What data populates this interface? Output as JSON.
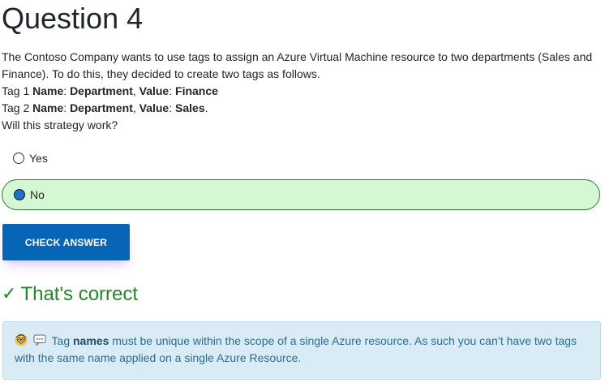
{
  "question": {
    "title": "Question 4",
    "intro": "The Contoso Company wants to use tags to assign an Azure Virtual Machine resource to two departments (Sales and Finance). To do this, they decided to create two tags as follows.",
    "tag1": {
      "prefix": "Tag 1 ",
      "name_label": "Name",
      "name_value": "Department",
      "value_label": "Value",
      "value_value": "Finance"
    },
    "tag2": {
      "prefix": "Tag 2 ",
      "name_label": "Name",
      "name_value": "Department",
      "value_label": "Value",
      "value_value": "Sales"
    },
    "prompt": "Will this strategy work?"
  },
  "options": [
    {
      "label": "Yes",
      "selected": false
    },
    {
      "label": "No",
      "selected": true
    }
  ],
  "check_button": {
    "label": "CHECK ANSWER"
  },
  "result": {
    "text": "That's correct",
    "color": "#1d8a25"
  },
  "explanation": {
    "prefix": "Tag ",
    "bold": "names",
    "rest": " must be unique within the scope of a single Azure resource. As such you can’t have two tags with the same name applied on a single Azure Resource.",
    "icons": [
      "nerd-face-icon",
      "speech-bubble-icon"
    ]
  },
  "colors": {
    "selected_bg": "#d4f8d3",
    "selected_border": "#2e7d32",
    "button_bg": "#0765b8",
    "info_bg": "#d9ecf5",
    "info_text": "#2c6d8c"
  }
}
